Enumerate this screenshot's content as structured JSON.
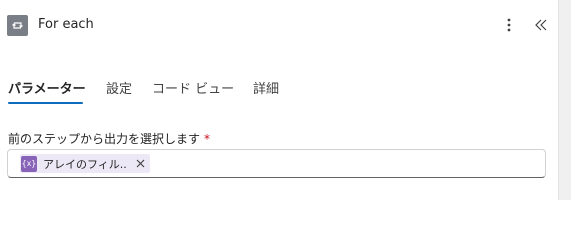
{
  "header": {
    "title": "For each",
    "action_icon": "loop-icon",
    "more_icon": "more-vertical-icon",
    "collapse_icon": "double-chevron-left-icon"
  },
  "tabs": [
    {
      "label": "パラメーター",
      "selected": true
    },
    {
      "label": "設定",
      "selected": false
    },
    {
      "label": "コード ビュー",
      "selected": false
    },
    {
      "label": "詳細",
      "selected": false
    }
  ],
  "field": {
    "label": "前のステップから出力を選択します",
    "required_mark": "*",
    "token": {
      "icon_text": "{x}",
      "text": "アレイのフィル...",
      "remove_icon": "close-icon"
    }
  },
  "colors": {
    "accent": "#0f6cbd",
    "token_bg": "#ece8f6",
    "token_icon": "#8764b8",
    "required": "#c50f1f"
  }
}
